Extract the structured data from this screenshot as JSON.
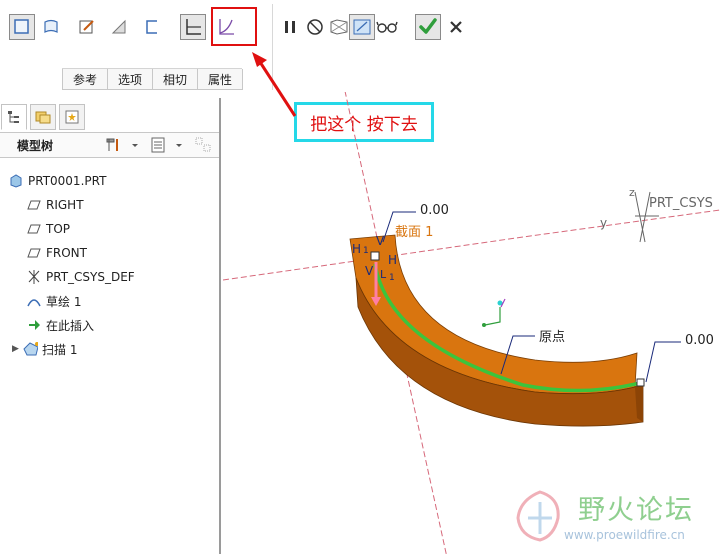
{
  "toolbar": {
    "tabs": [
      "参考",
      "选项",
      "相切",
      "属性"
    ],
    "buttons": [
      "solid-icon",
      "surface-icon",
      "sketch-edit-icon",
      "remove-material-icon",
      "thin-icon",
      "section-constant-icon",
      "section-variable-icon",
      "pause-icon",
      "no-preview-icon",
      "geometry-preview-icon",
      "verify-mode-icon",
      "glasses-icon",
      "confirm-icon",
      "cancel-icon"
    ],
    "confirm_color": "#2f9e3c"
  },
  "annotation": {
    "callout_text": "把这个  按下去",
    "highlight_color": "#e01010",
    "callout_border_color": "#25d8e8"
  },
  "tree": {
    "title": "模型树",
    "items": [
      {
        "label": "PRT0001.PRT",
        "icon": "part-icon"
      },
      {
        "label": "RIGHT",
        "icon": "datum-plane-icon"
      },
      {
        "label": "TOP",
        "icon": "datum-plane-icon"
      },
      {
        "label": "FRONT",
        "icon": "datum-plane-icon"
      },
      {
        "label": "PRT_CSYS_DEF",
        "icon": "csys-icon"
      },
      {
        "label": "草绘 1",
        "icon": "sketch-icon"
      },
      {
        "label": "在此插入",
        "icon": "insert-here-icon"
      },
      {
        "label": "扫描 1",
        "icon": "sweep-icon"
      }
    ]
  },
  "model": {
    "dim_top": "0.00",
    "dim_right": "0.00",
    "section_label": "截面 1",
    "origin_label": "原点",
    "csys_label": "PRT_CSYS",
    "axis_x": "y",
    "axis_z": "z",
    "marker_labels": [
      "H",
      "1",
      "V",
      "H",
      "1",
      "V",
      "L",
      "1"
    ],
    "sweep_color": "#d9750f",
    "trajectory_color": "#3cc43c"
  },
  "watermark": {
    "text": "野火论坛",
    "url": "www.proewildfire.cn"
  }
}
